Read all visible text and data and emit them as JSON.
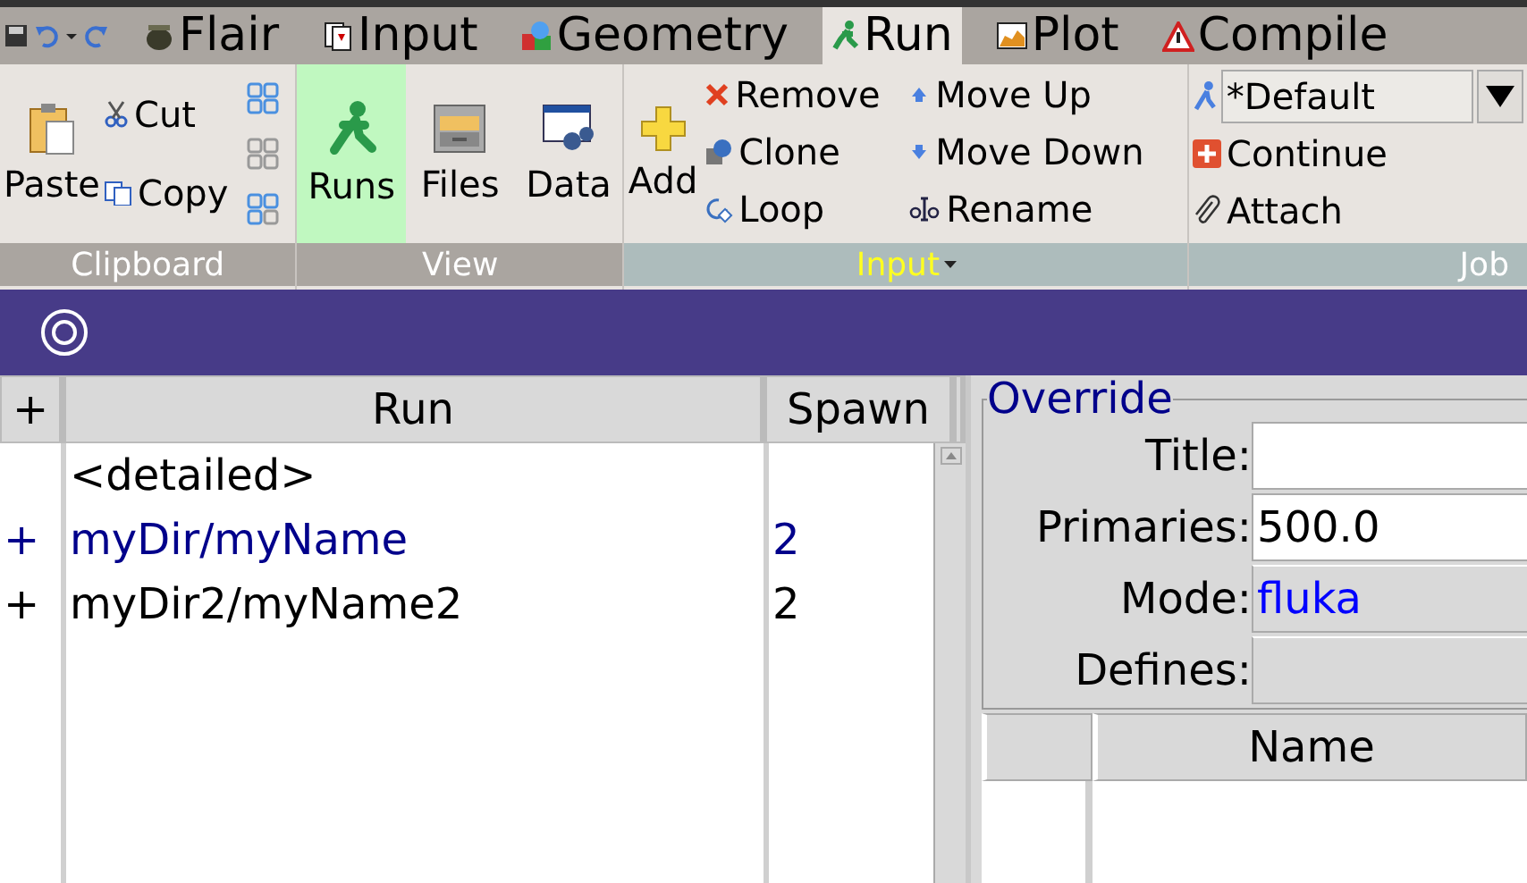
{
  "tabs": [
    {
      "label": "Flair",
      "selected": false
    },
    {
      "label": "Input",
      "selected": false
    },
    {
      "label": "Geometry",
      "selected": false
    },
    {
      "label": "Run",
      "selected": true
    },
    {
      "label": "Plot",
      "selected": false
    },
    {
      "label": "Compile",
      "selected": false
    }
  ],
  "ribbon": {
    "clipboard": {
      "label": "Clipboard",
      "contextual": false,
      "paste": "Paste",
      "cut": "Cut",
      "copy": "Copy"
    },
    "view": {
      "label": "View",
      "contextual": false,
      "buttons": [
        {
          "label": "Runs",
          "selected": true
        },
        {
          "label": "Files",
          "selected": false
        },
        {
          "label": "Data",
          "selected": false
        }
      ]
    },
    "input": {
      "label": "Input",
      "contextual": true,
      "highlighted": true,
      "add": "Add",
      "buttons": [
        "Remove",
        "Clone",
        "Loop",
        "Move Up",
        "Move Down",
        "Rename"
      ]
    },
    "job": {
      "label": "Job",
      "contextual": true,
      "highlighted": false,
      "profile": "*Default",
      "buttons": [
        "Continue",
        "Attach"
      ]
    }
  },
  "runs_table": {
    "columns": [
      "+",
      "Run",
      "Spawn"
    ],
    "rows": [
      {
        "run": "<detailed>",
        "color": "#000000"
      },
      {
        "expand": "+",
        "run": "myDir/myName",
        "spawn": "2",
        "color": "#00008b"
      },
      {
        "expand": "+",
        "run": "myDir2/myName2",
        "spawn": "2",
        "color": "#000000"
      }
    ]
  },
  "override": {
    "title": "Override",
    "fields": [
      {
        "label": "Title:",
        "kind": "entry"
      },
      {
        "label": "Primaries:",
        "kind": "entry",
        "value": "500.0"
      },
      {
        "label": "Mode:",
        "kind": "combo",
        "value": "fluka"
      },
      {
        "label": "Defines:",
        "kind": "combo"
      }
    ],
    "defines_table": {
      "columns": [
        "Name"
      ]
    }
  }
}
